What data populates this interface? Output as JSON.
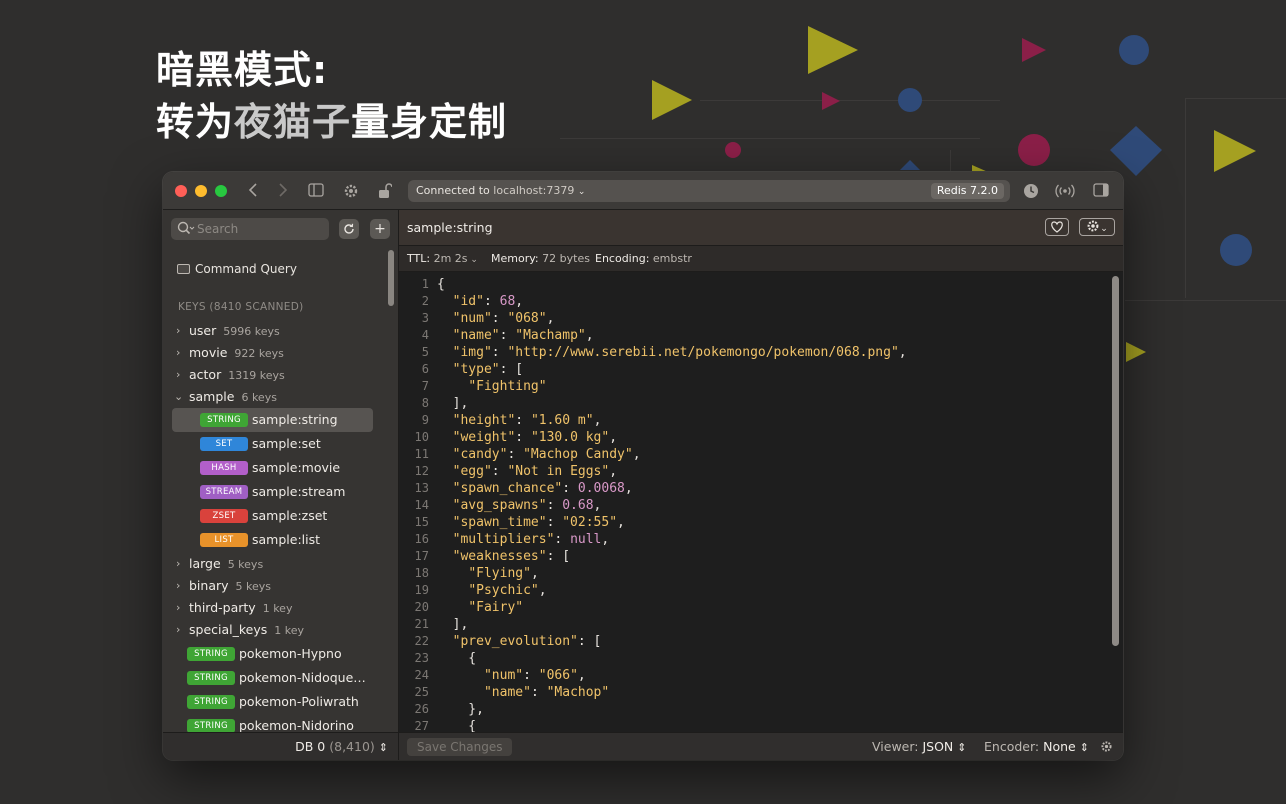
{
  "hero": {
    "line1": "暗黑模式:",
    "line2_prefix": "转为",
    "line2_accent": "夜猫子",
    "line2_suffix": "量身定制"
  },
  "titlebar": {
    "connected_label": "Connected to",
    "host": "localhost:7379",
    "redis_version": "Redis 7.2.0"
  },
  "sidebar": {
    "search_placeholder": "Search",
    "command_query_label": "Command Query",
    "keys_section_label": "KEYS (8410 SCANNED)",
    "groups_top": [
      {
        "name": "user",
        "count": "5996 keys",
        "expanded": false
      },
      {
        "name": "movie",
        "count": "922 keys",
        "expanded": false
      },
      {
        "name": "actor",
        "count": "1319 keys",
        "expanded": false
      },
      {
        "name": "sample",
        "count": "6 keys",
        "expanded": true
      }
    ],
    "sample_keys": [
      {
        "type": "STRING",
        "name": "sample:string",
        "color": "#3fa535",
        "selected": true
      },
      {
        "type": "SET",
        "name": "sample:set",
        "color": "#2f86d9",
        "selected": false
      },
      {
        "type": "HASH",
        "name": "sample:movie",
        "color": "#b25fc9",
        "selected": false
      },
      {
        "type": "STREAM",
        "name": "sample:stream",
        "color": "#a05fc4",
        "selected": false
      },
      {
        "type": "ZSET",
        "name": "sample:zset",
        "color": "#d9423c",
        "selected": false
      },
      {
        "type": "LIST",
        "name": "sample:list",
        "color": "#e8922a",
        "selected": false
      }
    ],
    "groups_bottom": [
      {
        "name": "large",
        "count": "5 keys"
      },
      {
        "name": "binary",
        "count": "5 keys"
      },
      {
        "name": "third-party",
        "count": "1 key"
      },
      {
        "name": "special_keys",
        "count": "1 key"
      }
    ],
    "root_keys": [
      {
        "type": "STRING",
        "name": "pokemon-Hypno",
        "color": "#3fa535"
      },
      {
        "type": "STRING",
        "name": "pokemon-Nidoque…",
        "color": "#3fa535"
      },
      {
        "type": "STRING",
        "name": "pokemon-Poliwrath",
        "color": "#3fa535"
      },
      {
        "type": "STRING",
        "name": "pokemon-Nidorino",
        "color": "#3fa535"
      }
    ],
    "db_label": "DB 0",
    "db_count": "(8,410)"
  },
  "main": {
    "key_title": "sample:string",
    "ttl_label": "TTL:",
    "ttl_value": "2m 2s",
    "memory_label": "Memory:",
    "memory_value": "72 bytes",
    "encoding_label": "Encoding:",
    "encoding_value": "embstr",
    "code_lines": [
      [
        [
          "p",
          "{"
        ]
      ],
      [
        [
          "p",
          "  "
        ],
        [
          "k",
          "\"id\""
        ],
        [
          "p",
          ": "
        ],
        [
          "n",
          "68"
        ],
        [
          "p",
          ","
        ]
      ],
      [
        [
          "p",
          "  "
        ],
        [
          "k",
          "\"num\""
        ],
        [
          "p",
          ": "
        ],
        [
          "s",
          "\"068\""
        ],
        [
          "p",
          ","
        ]
      ],
      [
        [
          "p",
          "  "
        ],
        [
          "k",
          "\"name\""
        ],
        [
          "p",
          ": "
        ],
        [
          "s",
          "\"Machamp\""
        ],
        [
          "p",
          ","
        ]
      ],
      [
        [
          "p",
          "  "
        ],
        [
          "k",
          "\"img\""
        ],
        [
          "p",
          ": "
        ],
        [
          "s",
          "\"http://www.serebii.net/pokemongo/pokemon/068.png\""
        ],
        [
          "p",
          ","
        ]
      ],
      [
        [
          "p",
          "  "
        ],
        [
          "k",
          "\"type\""
        ],
        [
          "p",
          ": ["
        ]
      ],
      [
        [
          "p",
          "    "
        ],
        [
          "s",
          "\"Fighting\""
        ]
      ],
      [
        [
          "p",
          "  ],"
        ]
      ],
      [
        [
          "p",
          "  "
        ],
        [
          "k",
          "\"height\""
        ],
        [
          "p",
          ": "
        ],
        [
          "s",
          "\"1.60 m\""
        ],
        [
          "p",
          ","
        ]
      ],
      [
        [
          "p",
          "  "
        ],
        [
          "k",
          "\"weight\""
        ],
        [
          "p",
          ": "
        ],
        [
          "s",
          "\"130.0 kg\""
        ],
        [
          "p",
          ","
        ]
      ],
      [
        [
          "p",
          "  "
        ],
        [
          "k",
          "\"candy\""
        ],
        [
          "p",
          ": "
        ],
        [
          "s",
          "\"Machop Candy\""
        ],
        [
          "p",
          ","
        ]
      ],
      [
        [
          "p",
          "  "
        ],
        [
          "k",
          "\"egg\""
        ],
        [
          "p",
          ": "
        ],
        [
          "s",
          "\"Not in Eggs\""
        ],
        [
          "p",
          ","
        ]
      ],
      [
        [
          "p",
          "  "
        ],
        [
          "k",
          "\"spawn_chance\""
        ],
        [
          "p",
          ": "
        ],
        [
          "n",
          "0.0068"
        ],
        [
          "p",
          ","
        ]
      ],
      [
        [
          "p",
          "  "
        ],
        [
          "k",
          "\"avg_spawns\""
        ],
        [
          "p",
          ": "
        ],
        [
          "n",
          "0.68"
        ],
        [
          "p",
          ","
        ]
      ],
      [
        [
          "p",
          "  "
        ],
        [
          "k",
          "\"spawn_time\""
        ],
        [
          "p",
          ": "
        ],
        [
          "s",
          "\"02:55\""
        ],
        [
          "p",
          ","
        ]
      ],
      [
        [
          "p",
          "  "
        ],
        [
          "k",
          "\"multipliers\""
        ],
        [
          "p",
          ": "
        ],
        [
          "nl",
          "null"
        ],
        [
          "p",
          ","
        ]
      ],
      [
        [
          "p",
          "  "
        ],
        [
          "k",
          "\"weaknesses\""
        ],
        [
          "p",
          ": ["
        ]
      ],
      [
        [
          "p",
          "    "
        ],
        [
          "s",
          "\"Flying\""
        ],
        [
          "p",
          ","
        ]
      ],
      [
        [
          "p",
          "    "
        ],
        [
          "s",
          "\"Psychic\""
        ],
        [
          "p",
          ","
        ]
      ],
      [
        [
          "p",
          "    "
        ],
        [
          "s",
          "\"Fairy\""
        ]
      ],
      [
        [
          "p",
          "  ],"
        ]
      ],
      [
        [
          "p",
          "  "
        ],
        [
          "k",
          "\"prev_evolution\""
        ],
        [
          "p",
          ": ["
        ]
      ],
      [
        [
          "p",
          "    {"
        ]
      ],
      [
        [
          "p",
          "      "
        ],
        [
          "k",
          "\"num\""
        ],
        [
          "p",
          ": "
        ],
        [
          "s",
          "\"066\""
        ],
        [
          "p",
          ","
        ]
      ],
      [
        [
          "p",
          "      "
        ],
        [
          "k",
          "\"name\""
        ],
        [
          "p",
          ": "
        ],
        [
          "s",
          "\"Machop\""
        ]
      ],
      [
        [
          "p",
          "    },"
        ]
      ],
      [
        [
          "p",
          "    {"
        ]
      ]
    ],
    "save_label": "Save Changes",
    "viewer_label": "Viewer:",
    "viewer_value": "JSON",
    "encoder_label": "Encoder:",
    "encoder_value": "None"
  }
}
